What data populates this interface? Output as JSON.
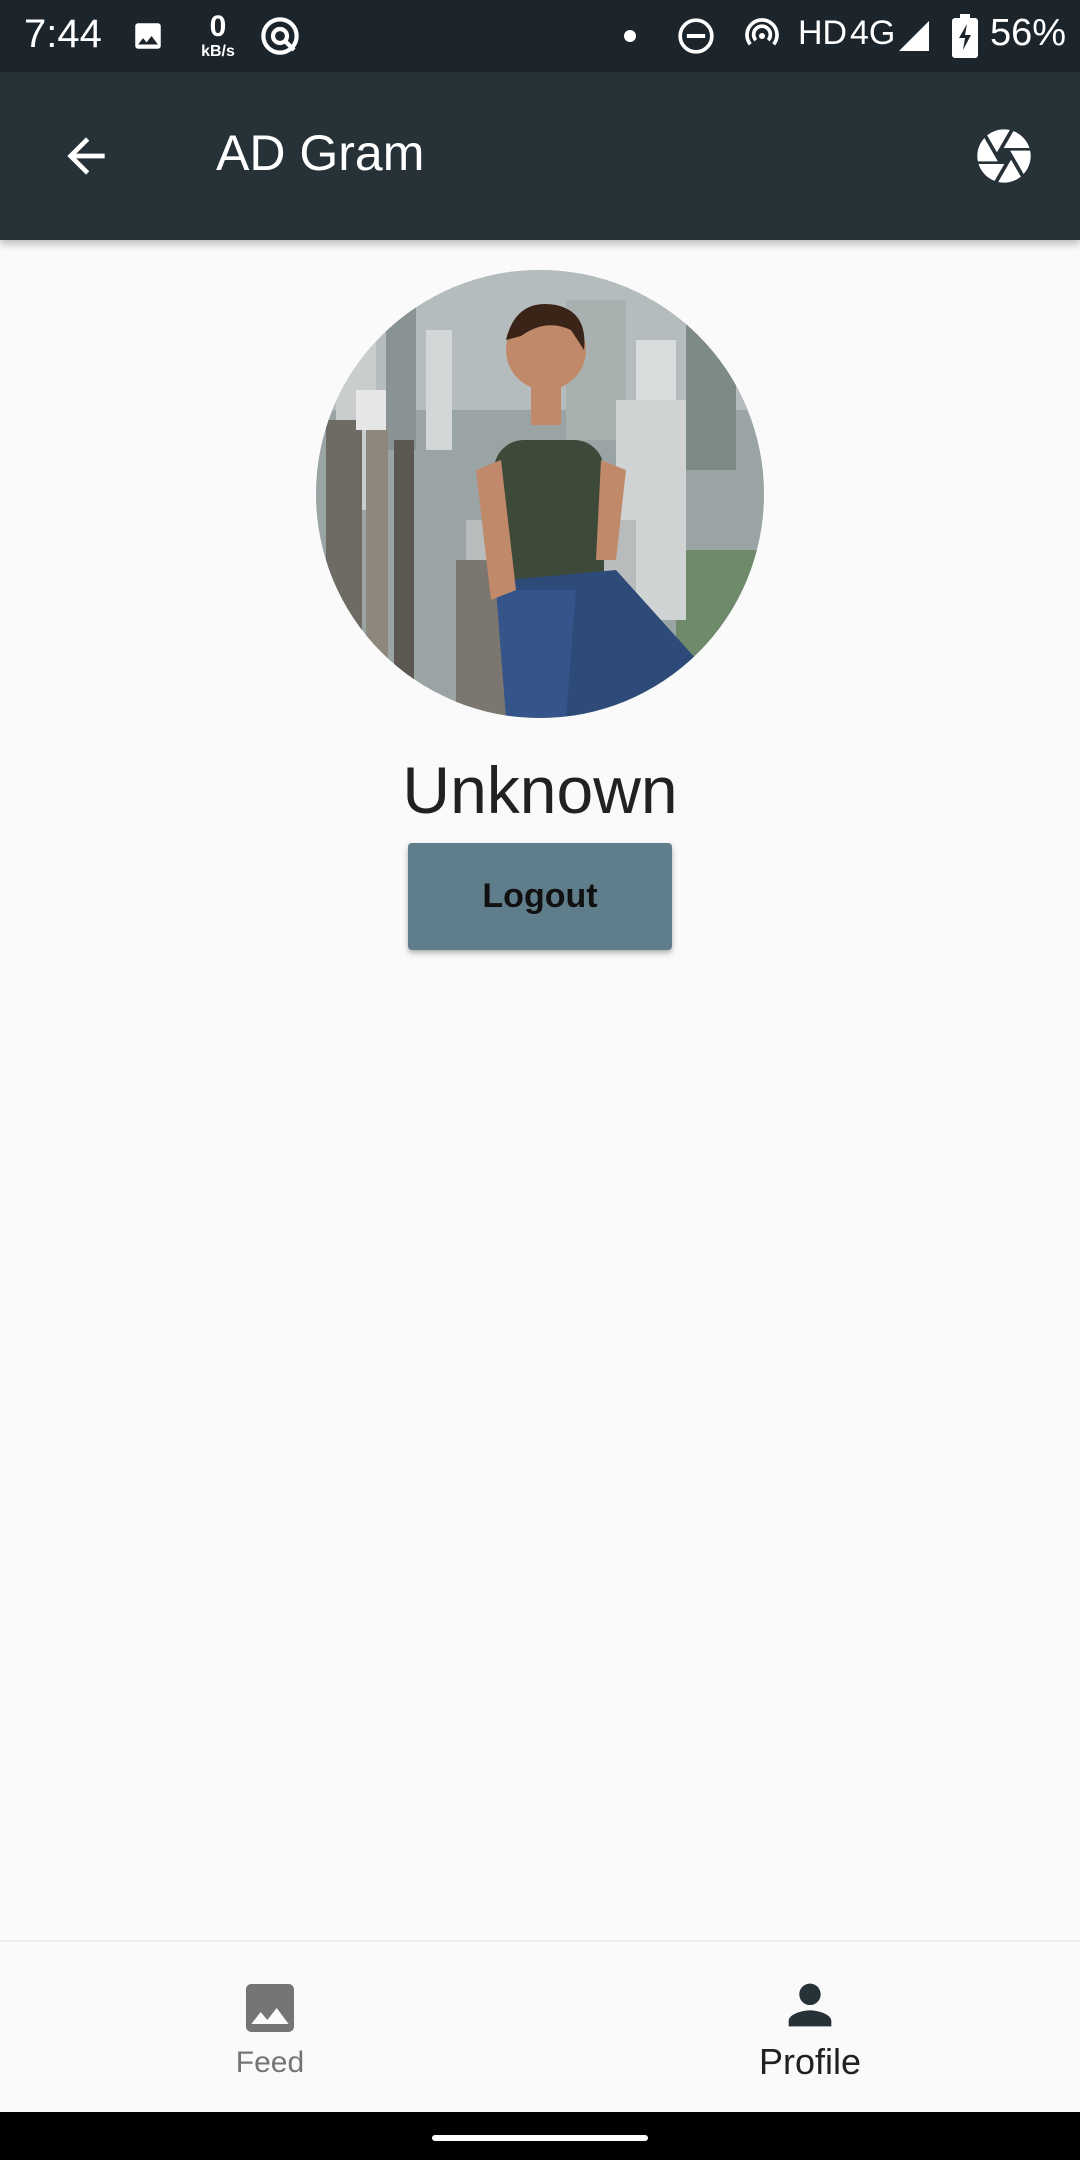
{
  "status_bar": {
    "time": "7:44",
    "speed_value": "0",
    "speed_unit": "kB/s",
    "hd": "HD",
    "network": "4G",
    "battery": "56%"
  },
  "app_bar": {
    "title": "AD Gram"
  },
  "profile": {
    "name": "Unknown",
    "logout_label": "Logout"
  },
  "bottom_nav": {
    "items": [
      {
        "label": "Feed",
        "icon": "image-icon",
        "active": false
      },
      {
        "label": "Profile",
        "icon": "person-icon",
        "active": true
      }
    ]
  },
  "colors": {
    "app_bar": "#263238",
    "status_bar": "#1c252c",
    "logout_button": "#607d8b",
    "background": "#fafafa"
  }
}
